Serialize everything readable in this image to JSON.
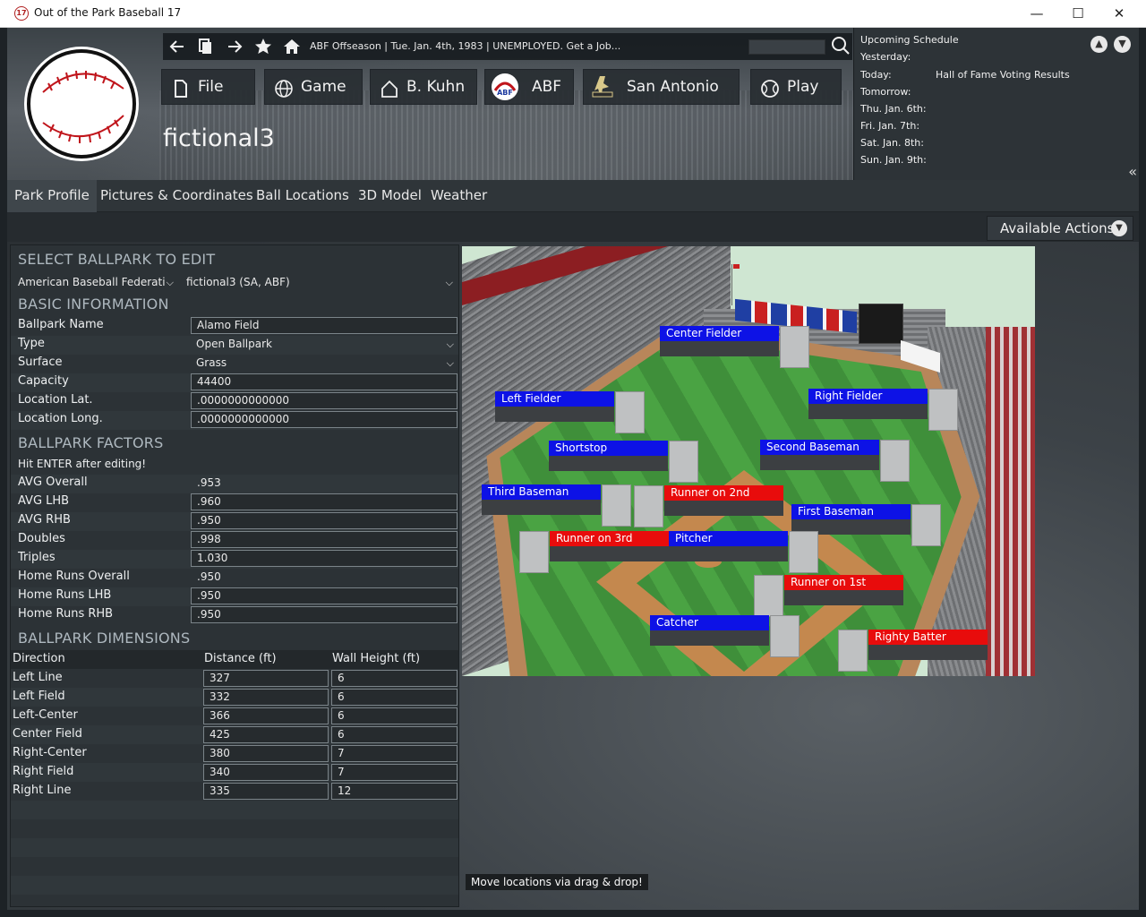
{
  "window": {
    "title": "Out of the Park Baseball 17",
    "icon_text": "17",
    "minimize": "—",
    "maximize": "☐",
    "close": "✕"
  },
  "header": {
    "status": "ABF Offseason  |  Tue. Jan. 4th, 1983  |  UNEMPLOYED. Get a Job...",
    "menu": [
      {
        "label": "File",
        "icon": "document-icon"
      },
      {
        "label": "Game",
        "icon": "globe-icon"
      },
      {
        "label": "B. Kuhn",
        "icon": "home-icon"
      },
      {
        "label": "ABF",
        "icon": "league-logo-icon"
      },
      {
        "label": "San Antonio",
        "icon": "team-logo-icon"
      },
      {
        "label": "Play",
        "icon": "baseball-icon"
      }
    ],
    "park_title": "fictional3"
  },
  "schedule": {
    "title": "Upcoming Schedule",
    "rows": [
      {
        "day": "Yesterday:",
        "event": ""
      },
      {
        "day": "Today:",
        "event": "Hall of Fame Voting Results"
      },
      {
        "day": "Tomorrow:",
        "event": ""
      },
      {
        "day": "Thu. Jan. 6th:",
        "event": ""
      },
      {
        "day": "Fri. Jan. 7th:",
        "event": ""
      },
      {
        "day": "Sat. Jan. 8th:",
        "event": ""
      },
      {
        "day": "Sun. Jan. 9th:",
        "event": ""
      }
    ]
  },
  "tabs": [
    "Park Profile",
    "Pictures & Coordinates",
    "Ball Locations",
    "3D Model",
    "Weather"
  ],
  "available_actions": "Available Actions",
  "select_section": {
    "heading": "SELECT BALLPARK TO EDIT",
    "league": "American Baseball Federati",
    "park": "fictional3 (SA, ABF)"
  },
  "basic_info": {
    "heading": "BASIC INFORMATION",
    "ballpark_name_label": "Ballpark Name",
    "ballpark_name": "Alamo Field",
    "type_label": "Type",
    "type": "Open Ballpark",
    "surface_label": "Surface",
    "surface": "Grass",
    "capacity_label": "Capacity",
    "capacity": "44400",
    "lat_label": "Location Lat.",
    "lat": ".0000000000000",
    "long_label": "Location Long.",
    "long": ".0000000000000"
  },
  "factors": {
    "heading": "BALLPARK FACTORS",
    "note": "Hit ENTER after editing!",
    "rows": [
      {
        "label": "AVG Overall",
        "value": ".953",
        "editable": false
      },
      {
        "label": "AVG LHB",
        "value": ".960",
        "editable": true
      },
      {
        "label": "AVG RHB",
        "value": ".950",
        "editable": true
      },
      {
        "label": "Doubles",
        "value": ".998",
        "editable": true
      },
      {
        "label": "Triples",
        "value": "1.030",
        "editable": true
      },
      {
        "label": "Home Runs Overall",
        "value": ".950",
        "editable": false
      },
      {
        "label": "Home Runs LHB",
        "value": ".950",
        "editable": true
      },
      {
        "label": "Home Runs RHB",
        "value": ".950",
        "editable": true
      }
    ]
  },
  "dimensions": {
    "heading": "BALLPARK DIMENSIONS",
    "col_direction": "Direction",
    "col_distance": "Distance (ft)",
    "col_wall": "Wall Height (ft)",
    "rows": [
      {
        "direction": "Left Line",
        "distance": "327",
        "wall": "6"
      },
      {
        "direction": "Left Field",
        "distance": "332",
        "wall": "6"
      },
      {
        "direction": "Left-Center",
        "distance": "366",
        "wall": "6"
      },
      {
        "direction": "Center Field",
        "distance": "425",
        "wall": "6"
      },
      {
        "direction": "Right-Center",
        "distance": "380",
        "wall": "7"
      },
      {
        "direction": "Right Field",
        "distance": "340",
        "wall": "7"
      },
      {
        "direction": "Right Line",
        "distance": "335",
        "wall": "12"
      }
    ]
  },
  "positions": {
    "center_fielder": "Center Fielder",
    "left_fielder": "Left Fielder",
    "right_fielder": "Right Fielder",
    "shortstop": "Shortstop",
    "second_baseman": "Second Baseman",
    "third_baseman": "Third Baseman",
    "runner_2nd": "Runner on 2nd",
    "first_baseman": "First Baseman",
    "runner_3rd": "Runner on 3rd",
    "pitcher": "Pitcher",
    "runner_1st": "Runner on 1st",
    "catcher": "Catcher",
    "righty_batter": "Righty Batter"
  },
  "drag_hint": "Move locations via drag & drop!",
  "colors": {
    "fielder_bar": "#0d12e6",
    "runner_bar": "#e80c0c",
    "accent_header": "#aeb8bf"
  }
}
